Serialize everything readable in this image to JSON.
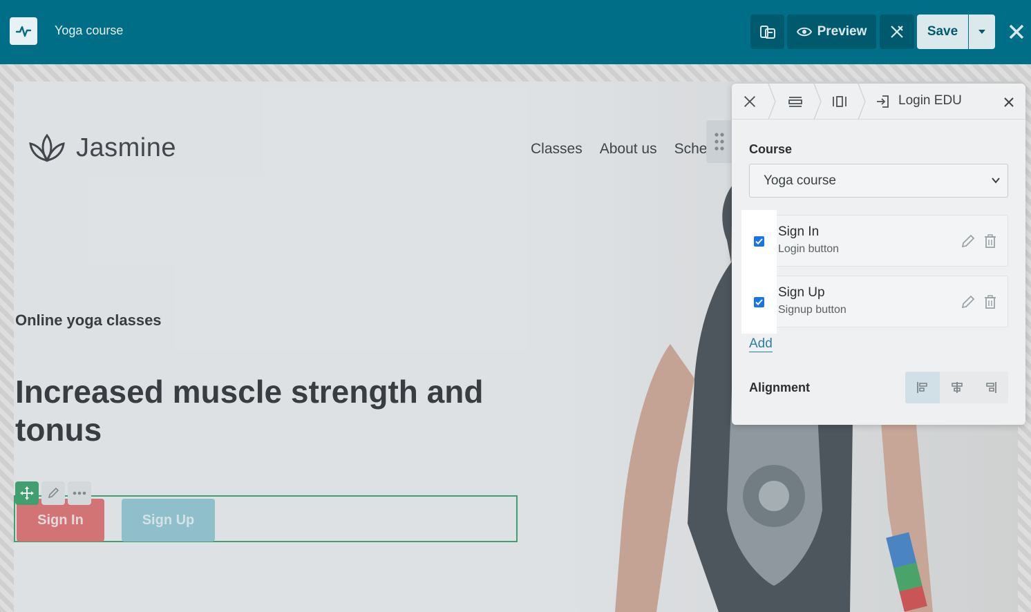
{
  "topbar": {
    "doc_title": "Yoga course",
    "preview_label": "Preview",
    "save_label": "Save",
    "icons": {
      "app": "pulse-icon",
      "pages": "pages-icon",
      "preview": "eye-icon",
      "design": "design-tools-icon",
      "dropdown": "caret-down-icon",
      "close": "close-icon"
    },
    "colors": {
      "bar": "#006e86",
      "save_bg": "#dce9ec"
    }
  },
  "site": {
    "logo_text": "Jasmine",
    "nav": [
      "Classes",
      "About us",
      "Sche"
    ],
    "eyebrow": "Online yoga classes",
    "headline": "Increased muscle strength and tonus",
    "buttons": {
      "sign_in": "Sign In",
      "sign_up": "Sign Up"
    },
    "colors": {
      "sign_in": "#e06b6b",
      "sign_up": "#8fc6d3",
      "selection": "#2f9e62"
    }
  },
  "panel": {
    "breadcrumb_label": "Login EDU",
    "course_label": "Course",
    "course_value": "Yoga course",
    "items": [
      {
        "title": "Sign In",
        "subtitle": "Login button",
        "checked": true
      },
      {
        "title": "Sign Up",
        "subtitle": "Signup button",
        "checked": true
      }
    ],
    "add_label": "Add",
    "alignment_label": "Alignment",
    "alignment_selected": "left"
  }
}
